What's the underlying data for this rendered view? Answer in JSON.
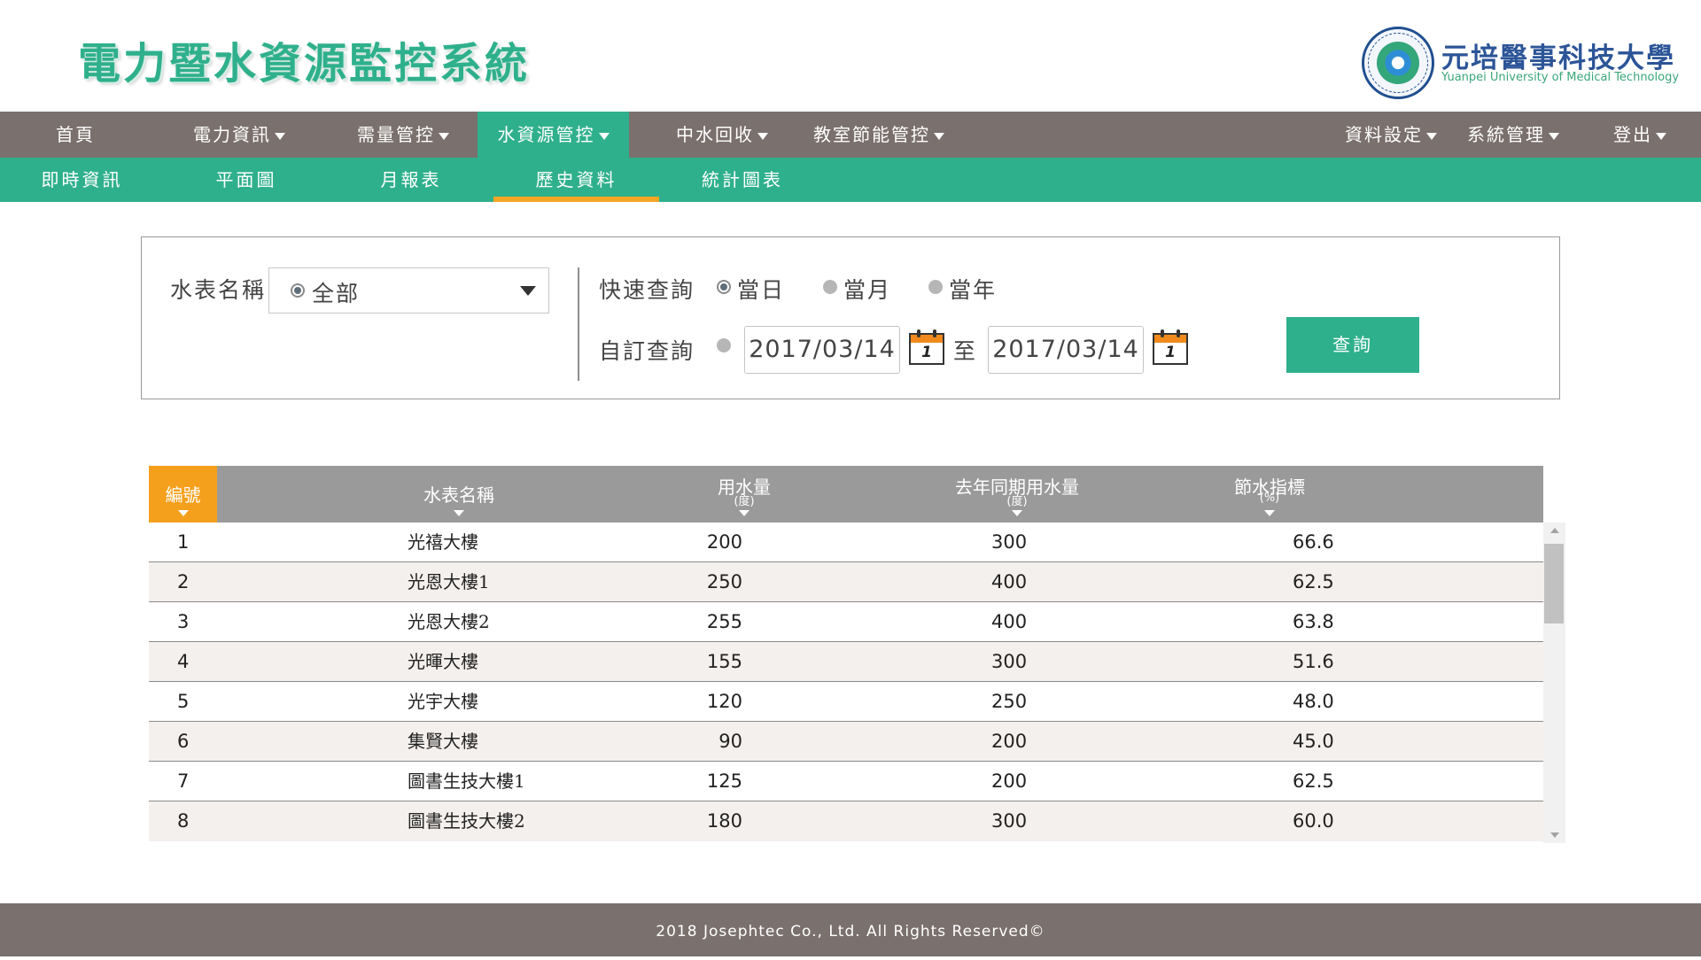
{
  "header": {
    "app_title": "電力暨水資源監控系統",
    "university_name": "元培醫事科技大學",
    "university_name_en": "Yuanpei University of Medical Technology"
  },
  "main_nav": {
    "items": [
      {
        "label": "首頁",
        "dropdown": false
      },
      {
        "label": "電力資訊",
        "dropdown": true
      },
      {
        "label": "需量管控",
        "dropdown": true
      },
      {
        "label": "水資源管控",
        "dropdown": true,
        "active": true
      },
      {
        "label": "中水回收",
        "dropdown": true
      },
      {
        "label": "教室節能管控",
        "dropdown": true
      },
      {
        "label": "資料設定",
        "dropdown": true
      },
      {
        "label": "系統管理",
        "dropdown": true
      },
      {
        "label": "登出",
        "dropdown": true
      }
    ]
  },
  "sub_nav": {
    "items": [
      {
        "label": "即時資訊"
      },
      {
        "label": "平面圖"
      },
      {
        "label": "月報表"
      },
      {
        "label": "歷史資料",
        "active": true
      },
      {
        "label": "統計圖表"
      }
    ]
  },
  "filter": {
    "meter_label": "水表名稱",
    "meter_value": "全部",
    "quick_label": "快速查詢",
    "quick_options": [
      {
        "label": "當日",
        "checked": true
      },
      {
        "label": "當月",
        "checked": false
      },
      {
        "label": "當年",
        "checked": false
      }
    ],
    "custom_label": "自訂查詢",
    "custom_checked": false,
    "date_from": "2017/03/14",
    "date_sep": "至",
    "date_to": "2017/03/14",
    "calendar_day": "1",
    "query_button": "查詢"
  },
  "table": {
    "columns": [
      {
        "label": "編號",
        "unit": ""
      },
      {
        "label": "水表名稱",
        "unit": ""
      },
      {
        "label": "用水量",
        "unit": "(度)"
      },
      {
        "label": "去年同期用水量",
        "unit": "(度)"
      },
      {
        "label": "節水指標",
        "unit": "(%)"
      }
    ],
    "rows": [
      {
        "no": "1",
        "name": "光禧大樓",
        "usage": "200",
        "last_year": "300",
        "index": "66.6"
      },
      {
        "no": "2",
        "name": "光恩大樓1",
        "usage": "250",
        "last_year": "400",
        "index": "62.5"
      },
      {
        "no": "3",
        "name": "光恩大樓2",
        "usage": "255",
        "last_year": "400",
        "index": "63.8"
      },
      {
        "no": "4",
        "name": "光暉大樓",
        "usage": "155",
        "last_year": "300",
        "index": "51.6"
      },
      {
        "no": "5",
        "name": "光宇大樓",
        "usage": "120",
        "last_year": "250",
        "index": "48.0"
      },
      {
        "no": "6",
        "name": "集賢大樓",
        "usage": "90",
        "last_year": "200",
        "index": "45.0"
      },
      {
        "no": "7",
        "name": "圖書生技大樓1",
        "usage": "125",
        "last_year": "200",
        "index": "62.5"
      },
      {
        "no": "8",
        "name": "圖書生技大樓2",
        "usage": "180",
        "last_year": "300",
        "index": "60.0"
      }
    ]
  },
  "footer": {
    "copyright": "2018 Josephtec Co., Ltd. All Rights Reserved©"
  },
  "colors": {
    "brand_green": "#2fb08c",
    "nav_gray": "#7a706d",
    "accent_orange": "#f5a623",
    "header_gray": "#9a9a9a"
  }
}
